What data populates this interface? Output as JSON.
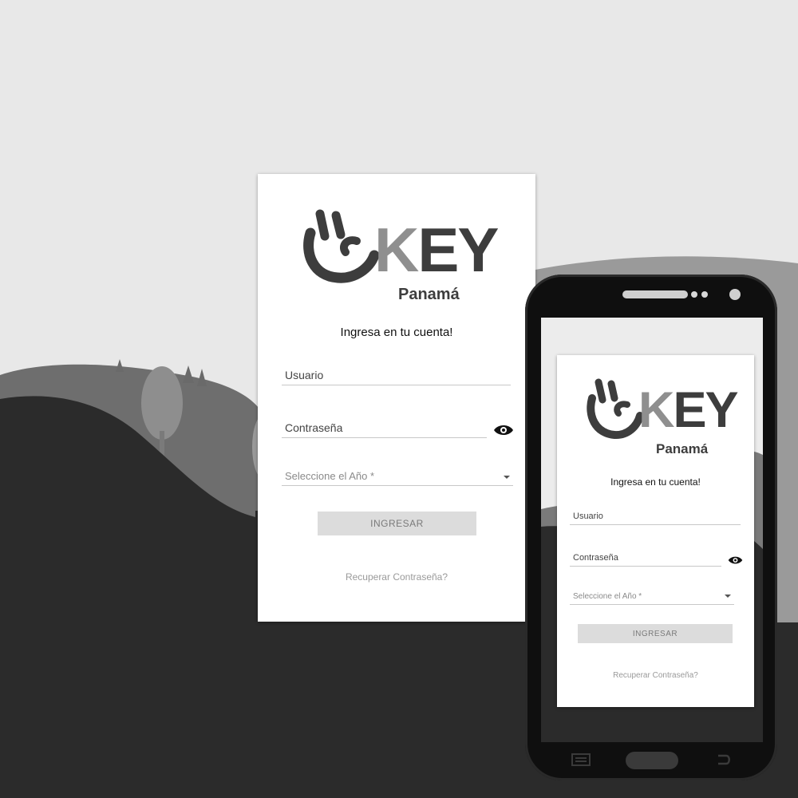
{
  "brand": {
    "logo_letters": "KEY",
    "logo_sub": "Panamá"
  },
  "desktop": {
    "subtitle": "Ingresa en tu cuenta!",
    "username_label": "Usuario",
    "password_label": "Contraseña",
    "year_select": "Seleccione el Año *",
    "submit_label": "INGRESAR",
    "recover_link": "Recuperar Contraseña?"
  },
  "mobile": {
    "subtitle": "Ingresa en tu cuenta!",
    "username_label": "Usuario",
    "password_label": "Contraseña",
    "year_select": "Seleccione el Año *",
    "submit_label": "INGRESAR",
    "recover_link": "Recuperar Contraseña?"
  },
  "colors": {
    "sky": "#e8e8e8",
    "hill_far": "#8c8c8c",
    "hill_mid": "#5e5e5e",
    "ground": "#2b2b2b",
    "phone": "#0f0f0f",
    "logo_dark": "#3d3d3d",
    "logo_light": "#8f8f8f"
  },
  "icons": [
    "ok-hand-logo-icon",
    "eye-icon",
    "caret-down-icon",
    "menu-icon",
    "back-icon"
  ]
}
